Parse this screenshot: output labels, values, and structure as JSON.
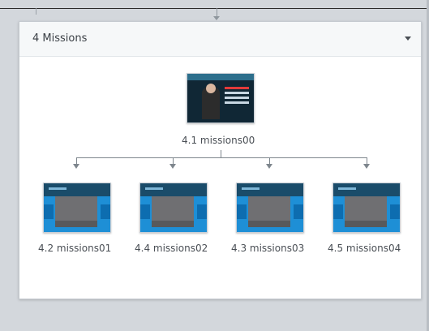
{
  "panel": {
    "title": "4 Missions"
  },
  "root_node": {
    "label": "4.1 missions00"
  },
  "children": [
    {
      "label": "4.2 missions01"
    },
    {
      "label": "4.4 missions02"
    },
    {
      "label": "4.3 missions03"
    },
    {
      "label": "4.5 missions04"
    }
  ],
  "colors": {
    "connector": "#7e868d",
    "panel_bg": "#ffffff",
    "canvas_bg": "#d3d7dc"
  },
  "icons": {
    "collapse": "chevron-down-icon"
  }
}
